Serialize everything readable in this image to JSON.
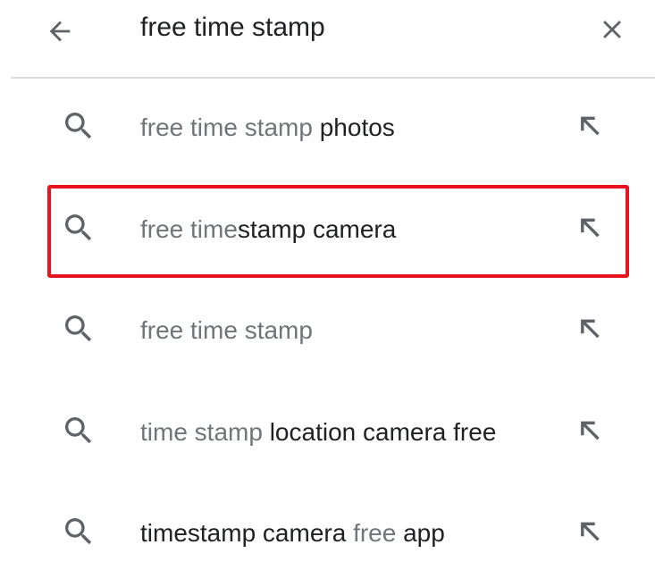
{
  "search": {
    "query": "free time stamp",
    "back_icon": "arrow-back-icon",
    "clear_icon": "close-icon"
  },
  "suggestions": [
    {
      "parts": [
        {
          "text": "free time stamp ",
          "style": "muted"
        },
        {
          "text": "photos",
          "style": "strong"
        }
      ]
    },
    {
      "parts": [
        {
          "text": "free time",
          "style": "muted"
        },
        {
          "text": "stamp camera",
          "style": "strong"
        }
      ]
    },
    {
      "parts": [
        {
          "text": "free time stamp",
          "style": "muted"
        }
      ]
    },
    {
      "parts": [
        {
          "text": "time stamp ",
          "style": "muted"
        },
        {
          "text": "location camera free",
          "style": "strong"
        }
      ]
    },
    {
      "parts": [
        {
          "text": "timestamp camera ",
          "style": "strong"
        },
        {
          "text": "free",
          "style": "muted"
        },
        {
          "text": " app",
          "style": "strong"
        }
      ]
    }
  ],
  "icons": {
    "suggestion_icon": "search-icon",
    "fill_icon": "arrow-up-left-icon"
  },
  "annotation": {
    "highlighted_index": 1,
    "color": "#e8141c"
  },
  "colors": {
    "muted_text": "#70757a",
    "strong_text": "#202124",
    "icon": "#5f6368",
    "divider": "#dadce0"
  }
}
